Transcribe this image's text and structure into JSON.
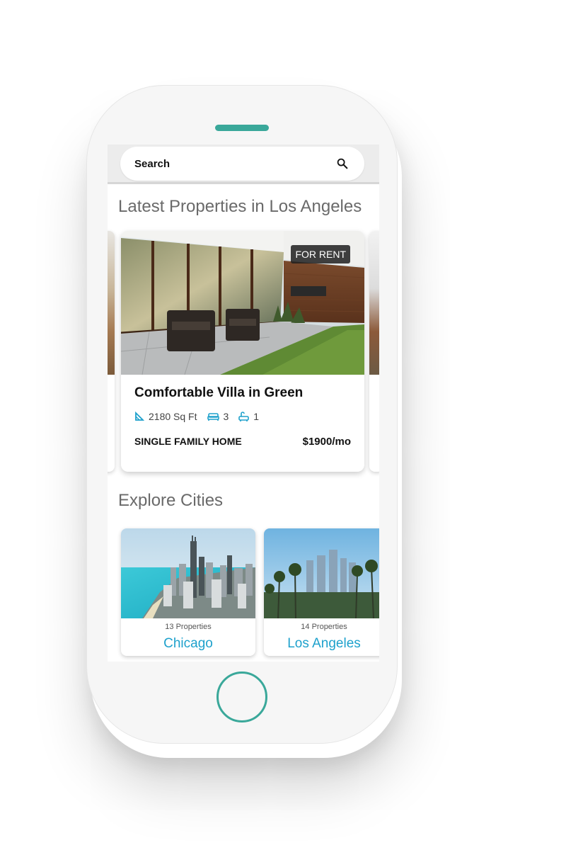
{
  "colors": {
    "accent": "#1ea1cc",
    "phone_accent": "#3aa89a",
    "badge_bg": "#1e1e1e"
  },
  "search": {
    "placeholder": "Search",
    "icon": "search-icon"
  },
  "sections": {
    "latest_title": "Latest Properties in Los Angeles",
    "explore_title": "Explore Cities"
  },
  "property": {
    "badge": "FOR RENT",
    "title": "Comfortable Villa in Green",
    "area": "2180 Sq Ft",
    "beds": "3",
    "baths": "1",
    "type": "SINGLE FAMILY HOME",
    "price": "$1900/mo",
    "icons": [
      "area-icon",
      "bed-icon",
      "bath-icon"
    ]
  },
  "cities": [
    {
      "count": "13 Properties",
      "name": "Chicago"
    },
    {
      "count": "14 Properties",
      "name": "Los Angeles"
    }
  ]
}
